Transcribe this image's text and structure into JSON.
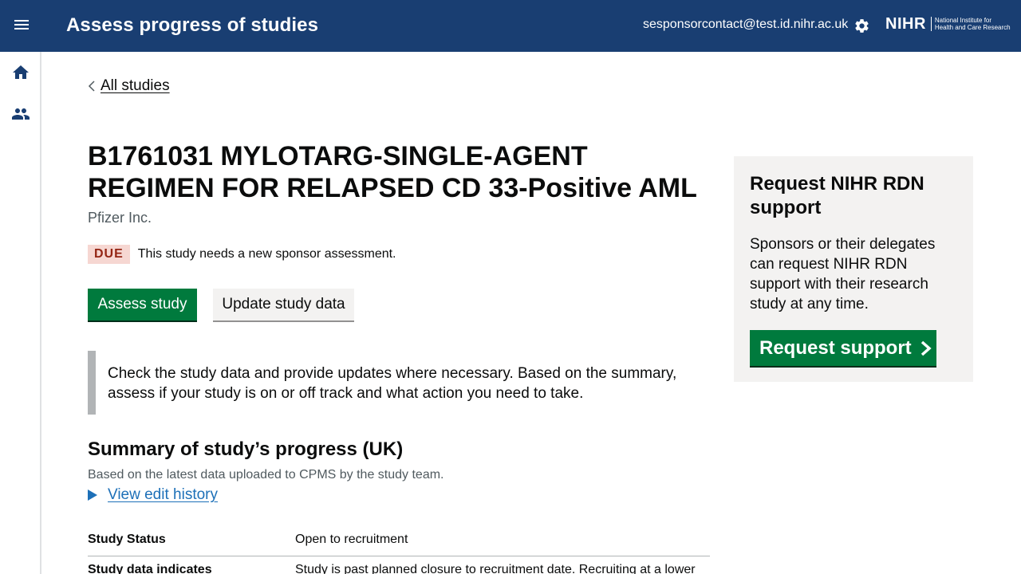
{
  "header": {
    "title": "Assess progress of studies",
    "user_email": "sesponsorcontact@test.id.nihr.ac.uk",
    "logo_text": "NIHR",
    "logo_subtext_line1": "National Institute for",
    "logo_subtext_line2": "Health and Care Research",
    "menu_icon": "hamburger-menu-icon",
    "settings_icon": "gear-icon"
  },
  "sidebar": {
    "items": [
      {
        "icon": "home-icon"
      },
      {
        "icon": "people-icon"
      }
    ]
  },
  "back_link": "All studies",
  "study": {
    "title": "B1761031 MYLOTARG-SINGLE-AGENT REGIMEN FOR RELAPSED CD 33-Positive AML",
    "sponsor": "Pfizer Inc.",
    "status_badge": "DUE",
    "status_message": "This study needs a new sponsor assessment."
  },
  "actions": {
    "assess_label": "Assess study",
    "update_label": "Update study data"
  },
  "inset_text": "Check the study data and provide updates where necessary. Based on the summary, assess if your study is on or off track and what action you need to take.",
  "summary": {
    "title": "Summary of study’s progress (UK)",
    "subtitle": "Based on the latest data uploaded to CPMS by the study team.",
    "history_link": "View edit history",
    "rows": [
      {
        "key": "Study Status",
        "value": "Open to recruitment"
      },
      {
        "key": "Study data indicates",
        "value": "Study is past planned closure to recruitment date. Recruiting at a lower"
      }
    ]
  },
  "aside": {
    "title": "Request NIHR RDN support",
    "text": "Sponsors or their delegates can request NIHR RDN support with their research study at any time.",
    "button_label": "Request support"
  },
  "colors": {
    "header_bg": "#193e72",
    "primary_green": "#007a3d",
    "link_blue": "#1d70b8",
    "due_bg": "#f6d7d2",
    "due_text": "#942514"
  }
}
